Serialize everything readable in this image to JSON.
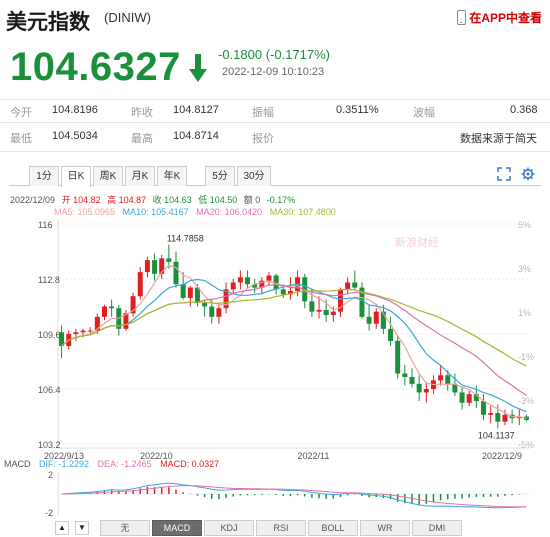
{
  "header": {
    "title": "美元指数",
    "code": "(DINIW)",
    "app_link": "在APP中查看"
  },
  "quote": {
    "price": "104.6327",
    "change": "-0.1800 (-0.1717%)",
    "time": "2022-12-09 10:10:23"
  },
  "stats": {
    "row1": [
      {
        "label": "今开",
        "value": "104.8196"
      },
      {
        "label": "昨收",
        "value": "104.8127"
      },
      {
        "label": "振幅",
        "value": "0.3511%"
      },
      {
        "label": "波幅",
        "value": "0.368"
      }
    ],
    "row2": [
      {
        "label": "最低",
        "value": "104.5034"
      },
      {
        "label": "最高",
        "value": "104.8714"
      },
      {
        "label": "报价",
        "value": "数据来源于简天"
      }
    ]
  },
  "tabs": [
    "1分",
    "日K",
    "周K",
    "月K",
    "年K",
    "5分",
    "30分"
  ],
  "active_tab": "日K",
  "info_line": {
    "date": "2022/12/09",
    "open": "开 104.82",
    "high": "高 104.87",
    "close": "收 104.63",
    "low": "低 104.50",
    "change": "额 0",
    "pct": "-0.17%"
  },
  "ma_line": [
    {
      "name": "MA5: 105.0965",
      "color": "#f0a0a0"
    },
    {
      "name": "MA10: 105.4167",
      "color": "#38a8d8"
    },
    {
      "name": "MA20: 106.0420",
      "color": "#e070b0"
    },
    {
      "name": "MA30: 107.4800",
      "color": "#a8b830"
    }
  ],
  "macd_line": {
    "label": "MACD",
    "dif": "DIF: -1.2292",
    "dea": "DEA: -1.2465",
    "macd": "MACD: 0.0327"
  },
  "indicators": [
    "无",
    "MACD",
    "KDJ",
    "RSI",
    "BOLL",
    "WR",
    "DMI"
  ],
  "active_indicator": "MACD",
  "watermark": "新浪财经",
  "colors": {
    "up": "#e02020",
    "down": "#1a8f3c",
    "ma5": "#f0a0a0",
    "ma10": "#38a8d8",
    "ma20": "#e070b0",
    "ma30": "#a8b830"
  },
  "chart_data": {
    "type": "candlestick",
    "y_left_ticks": [
      "116",
      "112.8",
      "109.6",
      "106.4",
      "103.2"
    ],
    "y_right_ticks": [
      "5%",
      "3%",
      "1%",
      "-1%",
      "-3%",
      "-5%"
    ],
    "x_ticks": [
      "2022/9/13",
      "2022/10",
      "2022/11",
      "2022/12/9"
    ],
    "ylim": [
      103.2,
      116
    ],
    "annotations": {
      "max": "114.7858",
      "min": "104.1137"
    },
    "macd_y_ticks": [
      "2",
      "-2"
    ],
    "ohlc": [
      [
        109.7,
        110.1,
        108.2,
        108.9
      ],
      [
        108.9,
        109.8,
        108.7,
        109.6
      ],
      [
        109.6,
        109.9,
        109.2,
        109.7
      ],
      [
        109.7,
        109.9,
        109.4,
        109.8
      ],
      [
        109.8,
        110.0,
        109.5,
        109.8
      ],
      [
        109.8,
        110.8,
        109.6,
        110.6
      ],
      [
        110.6,
        111.3,
        110.4,
        111.2
      ],
      [
        111.2,
        111.6,
        110.6,
        111.1
      ],
      [
        111.1,
        111.3,
        109.5,
        109.9
      ],
      [
        109.9,
        111.0,
        109.8,
        110.8
      ],
      [
        110.8,
        112.0,
        110.6,
        111.8
      ],
      [
        111.8,
        113.5,
        111.6,
        113.2
      ],
      [
        113.2,
        114.1,
        112.9,
        113.9
      ],
      [
        113.9,
        114.3,
        112.7,
        113.1
      ],
      [
        113.1,
        114.2,
        112.8,
        114.0
      ],
      [
        114.0,
        114.8,
        113.4,
        113.8
      ],
      [
        113.8,
        114.4,
        112.3,
        112.5
      ],
      [
        112.5,
        113.2,
        111.6,
        111.7
      ],
      [
        111.7,
        112.4,
        111.2,
        112.3
      ],
      [
        112.3,
        112.5,
        111.2,
        111.4
      ],
      [
        111.4,
        111.6,
        110.6,
        111.2
      ],
      [
        111.2,
        111.6,
        110.2,
        110.6
      ],
      [
        110.6,
        111.3,
        110.2,
        111.1
      ],
      [
        111.1,
        112.6,
        110.8,
        112.2
      ],
      [
        112.2,
        112.8,
        111.9,
        112.6
      ],
      [
        112.6,
        113.3,
        112.2,
        112.9
      ],
      [
        112.9,
        113.3,
        112.3,
        112.5
      ],
      [
        112.5,
        112.8,
        112.0,
        112.3
      ],
      [
        112.3,
        112.9,
        111.9,
        112.7
      ],
      [
        112.7,
        113.2,
        112.4,
        113.0
      ],
      [
        113.0,
        113.1,
        111.9,
        112.2
      ],
      [
        112.2,
        112.5,
        111.7,
        111.9
      ],
      [
        111.9,
        112.9,
        111.6,
        112.1
      ],
      [
        112.1,
        113.3,
        111.8,
        112.9
      ],
      [
        112.9,
        113.1,
        111.1,
        111.5
      ],
      [
        111.5,
        112.2,
        110.6,
        110.9
      ],
      [
        110.9,
        111.8,
        110.5,
        111.0
      ],
      [
        111.0,
        111.6,
        110.3,
        110.7
      ],
      [
        110.7,
        111.2,
        110.3,
        110.9
      ],
      [
        110.9,
        112.3,
        110.6,
        112.2
      ],
      [
        112.2,
        112.9,
        111.9,
        112.6
      ],
      [
        112.6,
        113.3,
        112.2,
        112.3
      ],
      [
        112.3,
        112.6,
        110.5,
        110.6
      ],
      [
        110.6,
        111.3,
        109.8,
        110.2
      ],
      [
        110.2,
        111.1,
        109.9,
        110.9
      ],
      [
        110.9,
        111.3,
        109.6,
        109.9
      ],
      [
        109.9,
        110.6,
        108.9,
        109.2
      ],
      [
        109.2,
        109.5,
        107.0,
        107.3
      ],
      [
        107.3,
        107.8,
        106.6,
        107.1
      ],
      [
        107.1,
        107.6,
        106.5,
        106.7
      ],
      [
        106.7,
        107.2,
        105.7,
        106.2
      ],
      [
        106.2,
        106.8,
        105.6,
        106.4
      ],
      [
        106.4,
        107.2,
        106.1,
        106.9
      ],
      [
        106.9,
        107.8,
        106.6,
        107.2
      ],
      [
        107.2,
        107.5,
        106.3,
        106.7
      ],
      [
        106.7,
        107.3,
        106.0,
        106.2
      ],
      [
        106.2,
        106.5,
        105.2,
        105.6
      ],
      [
        105.6,
        106.3,
        105.4,
        106.1
      ],
      [
        106.1,
        106.6,
        105.3,
        105.7
      ],
      [
        105.7,
        106.1,
        104.6,
        104.9
      ],
      [
        104.9,
        105.4,
        104.4,
        105.0
      ],
      [
        105.0,
        105.5,
        104.1,
        104.5
      ],
      [
        104.5,
        105.2,
        104.3,
        104.9
      ],
      [
        104.9,
        105.2,
        104.4,
        104.7
      ],
      [
        104.7,
        105.2,
        104.3,
        104.8
      ],
      [
        104.8,
        104.9,
        104.5,
        104.6
      ]
    ]
  }
}
